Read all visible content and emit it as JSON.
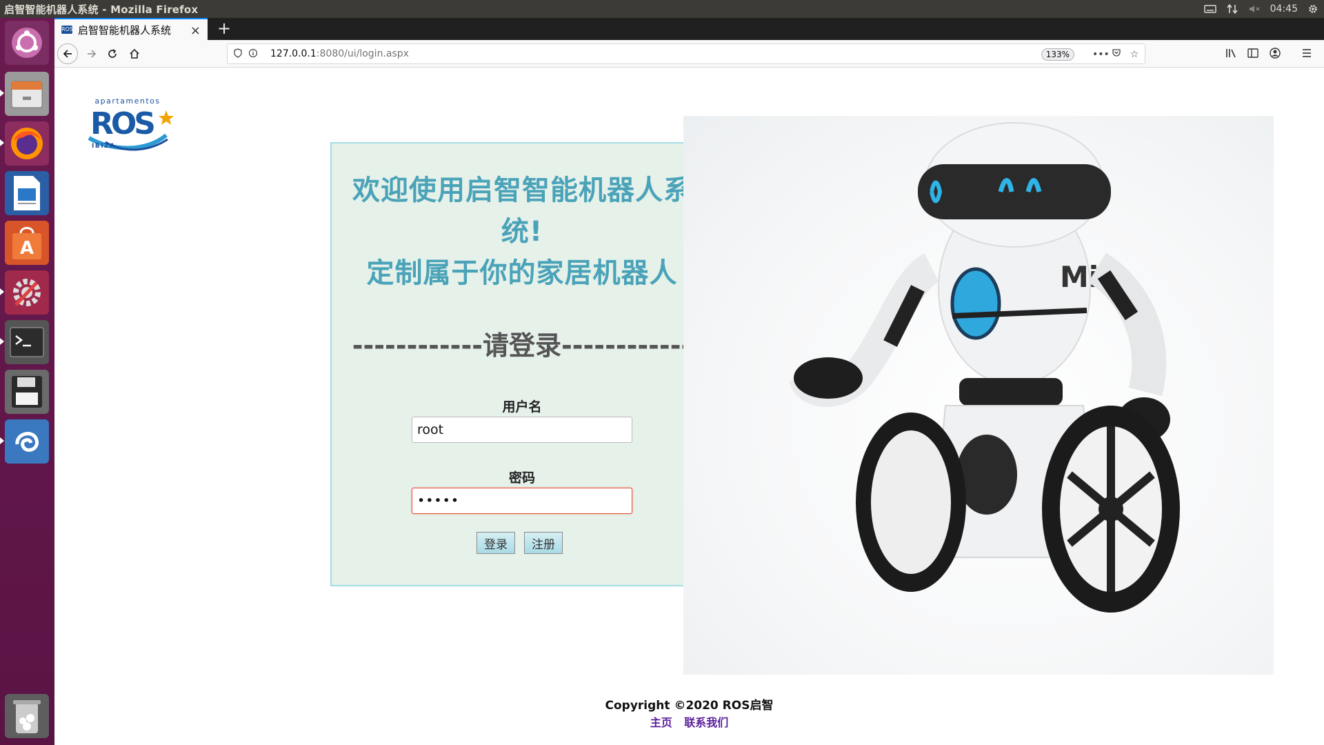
{
  "top_panel": {
    "window_title": "启智智能机器人系统 - Mozilla Firefox",
    "clock": "04:45"
  },
  "launcher": {
    "items": [
      "ubuntu-dash",
      "files",
      "firefox",
      "libreoffice-writer",
      "software-center",
      "system-settings",
      "terminal",
      "save-disk",
      "app",
      "trash"
    ]
  },
  "browser": {
    "tab_title": "启智智能机器人系统",
    "tab_favicon": "ROS",
    "url_host": "127.0.0.1",
    "url_path": ":8080/ui/login.aspx",
    "zoom": "133%"
  },
  "page": {
    "logo_small_text": "apartamentos",
    "logo_main_text": "ROS",
    "logo_sub_text": "IBIZA",
    "welcome_line1": "欢迎使用启智智能机器人系统!",
    "welcome_line2": "定制属于你的家居机器人",
    "login_heading": "------------请登录------------",
    "username_label": "用户名",
    "username_value": "root",
    "password_label": "密码",
    "password_value": "•••••",
    "login_button": "登录",
    "register_button": "注册",
    "robot_brand": "MiP",
    "copyright": "Copyright ©2020 ROS启智",
    "footer_link_home": "主页",
    "footer_link_contact": "联系我们"
  },
  "colors": {
    "welcome_text": "#4aa3b8",
    "panel_bg": "#e6f1ea",
    "panel_border": "#a6dbe3",
    "launcher_bg": "#5a1444",
    "footer_link": "#5a1f9c"
  }
}
